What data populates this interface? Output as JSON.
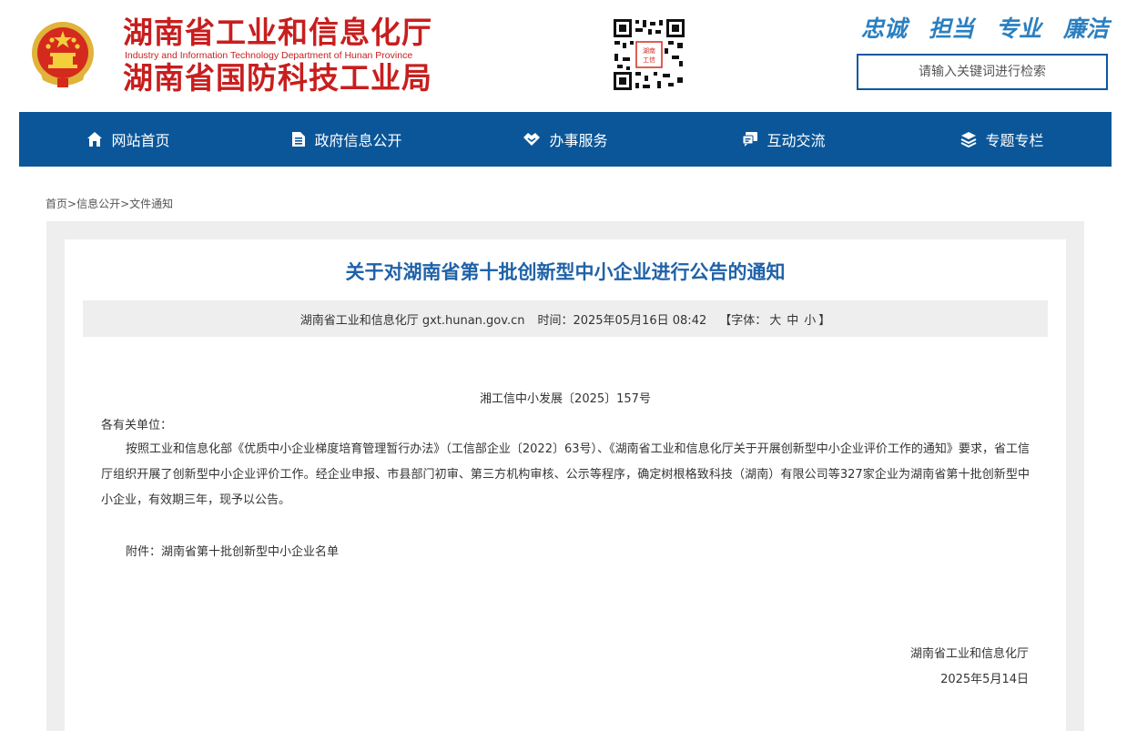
{
  "header": {
    "title_line1": "湖南省工业和信息化厅",
    "title_en": "Industry and Information Technology Department of Hunan Province",
    "title_line2": "湖南省国防科技工业局",
    "slogans": [
      "忠诚",
      "担当",
      "专业",
      "廉洁"
    ],
    "search_placeholder": "请输入关键词进行检索",
    "emblem_icon": "national-emblem-icon",
    "qr_icon": "qr-code-icon"
  },
  "nav": {
    "items": [
      {
        "label": "网站首页",
        "icon": "home-icon"
      },
      {
        "label": "政府信息公开",
        "icon": "document-icon"
      },
      {
        "label": "办事服务",
        "icon": "handshake-icon"
      },
      {
        "label": "互动交流",
        "icon": "chat-icon"
      },
      {
        "label": "专题专栏",
        "icon": "layers-icon"
      }
    ]
  },
  "breadcrumb": {
    "items": [
      "首页",
      "信息公开",
      "文件通知"
    ],
    "separator": ">"
  },
  "article": {
    "title": "关于对湖南省第十批创新型中小企业进行公告的通知",
    "meta": {
      "source": "湖南省工业和信息化厅 gxt.hunan.gov.cn",
      "time": "时间：2025年05月16日 08:42",
      "font_label_open": "【字体：",
      "font_sizes": [
        "大",
        "中",
        "小"
      ],
      "font_label_close": "】"
    },
    "doc_number": "湘工信中小发展〔2025〕157号",
    "salutation": "各有关单位：",
    "body": "按照工业和信息化部《优质中小企业梯度培育管理暂行办法》（工信部企业〔2022〕63号）、《湖南省工业和信息化厅关于开展创新型中小企业评价工作的通知》要求，省工信厅组织开展了创新型中小企业评价工作。经企业申报、市县部门初审、第三方机构审核、公示等程序，确定树根格致科技（湖南）有限公司等327家企业为湖南省第十批创新型中小企业，有效期三年，现予以公告。",
    "attachment": "附件：湖南省第十批创新型中小企业名单",
    "signature": "湖南省工业和信息化厅",
    "date": "2025年5月14日"
  },
  "colors": {
    "brand_red": "#c81e1e",
    "nav_blue": "#0a5699",
    "title_blue": "#1f62a8",
    "slogan_blue": "#2b7fc0"
  }
}
